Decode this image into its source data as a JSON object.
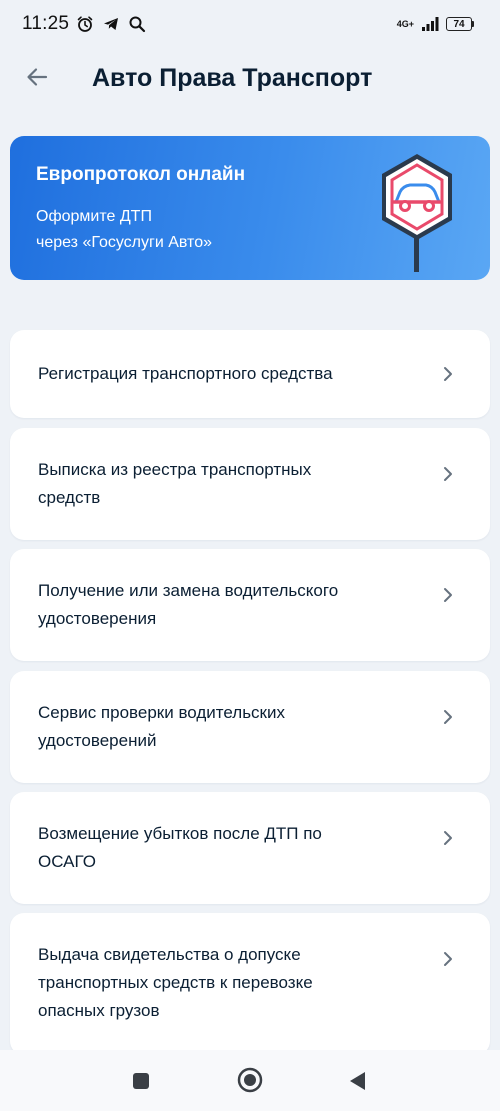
{
  "status_bar": {
    "time": "11:25",
    "network": "4G+",
    "battery": "74",
    "icons": [
      "alarm-icon",
      "telegram-icon",
      "search-icon",
      "signal-icon",
      "battery-icon"
    ]
  },
  "header": {
    "back_icon": "arrow-left-icon",
    "title": "Авто Права Транспорт"
  },
  "banner": {
    "title": "Европротокол онлайн",
    "subtitle_line1": "Оформите ДТП",
    "subtitle_line2": "через «Госуслуги Авто»",
    "logo_icon": "car-road-sign-icon",
    "gradient_start": "#1f6fde",
    "gradient_end": "#5aa7f4"
  },
  "services": [
    {
      "line1": "Регистрация транспортного средства"
    },
    {
      "line1": "Выписка из реестра транспортных",
      "line2": "средств"
    },
    {
      "line1": "Получение или замена водительского",
      "line2": "удостоверения"
    },
    {
      "line1": "Сервис проверки водительских",
      "line2": "удостоверений"
    },
    {
      "line1": "Возмещение убытков после ДТП по",
      "line2": "ОСАГО"
    },
    {
      "line1": "Выдача свидетельства о допуске",
      "line2": "транспортных средств к перевозке",
      "line3": "опасных грузов"
    }
  ],
  "nav": {
    "icons": [
      "recent-apps-icon",
      "home-icon",
      "back-triangle-icon"
    ]
  },
  "colors": {
    "background": "#eef2f7",
    "text": "#0b1f33",
    "chevron": "#66727f"
  }
}
